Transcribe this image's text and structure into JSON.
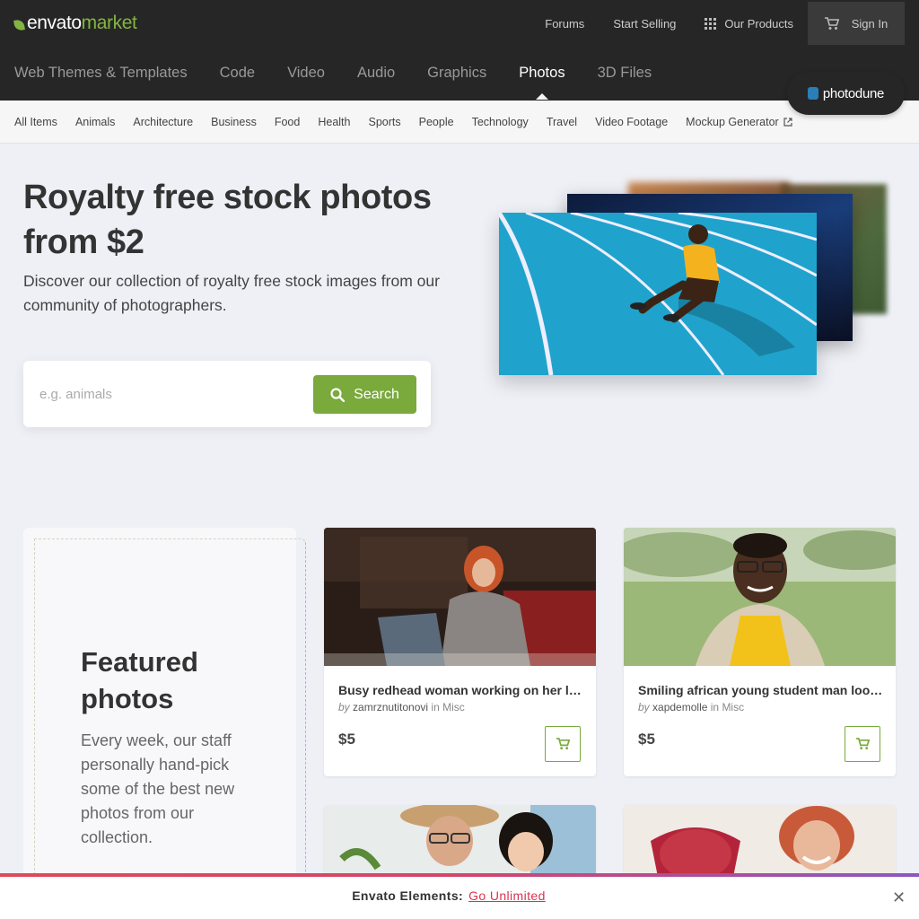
{
  "brand": {
    "envato": "envato",
    "market": "market",
    "accent": "#82b541"
  },
  "toplinks": {
    "forums": "Forums",
    "start_selling": "Start Selling",
    "our_products": "Our Products",
    "sign_in": "Sign In"
  },
  "mainnav": [
    "Web Themes & Templates",
    "Code",
    "Video",
    "Audio",
    "Graphics",
    "Photos",
    "3D Files"
  ],
  "mainnav_active": "Photos",
  "badge": {
    "label": "photodune"
  },
  "subnav": [
    "All Items",
    "Animals",
    "Architecture",
    "Business",
    "Food",
    "Health",
    "Sports",
    "People",
    "Technology",
    "Travel",
    "Video Footage",
    "Mockup Generator"
  ],
  "hero": {
    "title": "Royalty free stock photos from $2",
    "subtitle": "Discover our collection of royalty free stock images from our community of photographers."
  },
  "search": {
    "placeholder": "e.g. animals",
    "button_label": "Search",
    "button_color": "#7aa93c"
  },
  "featured": {
    "title": "Featured photos",
    "description": "Every week, our staff personally hand-pick some of the best new photos from our collection."
  },
  "cards": [
    {
      "title": "Busy redhead woman working on her laptop",
      "by": "by",
      "author": "zamrznutitonovi",
      "in": "in",
      "category": "Misc",
      "price": "$5"
    },
    {
      "title": "Smiling african young student man looking at camera",
      "by": "by",
      "author": "xapdemolle",
      "in": "in",
      "category": "Misc",
      "price": "$5"
    }
  ],
  "banner": {
    "label": "Envato Elements:",
    "link": "Go Unlimited",
    "close": "✕"
  }
}
